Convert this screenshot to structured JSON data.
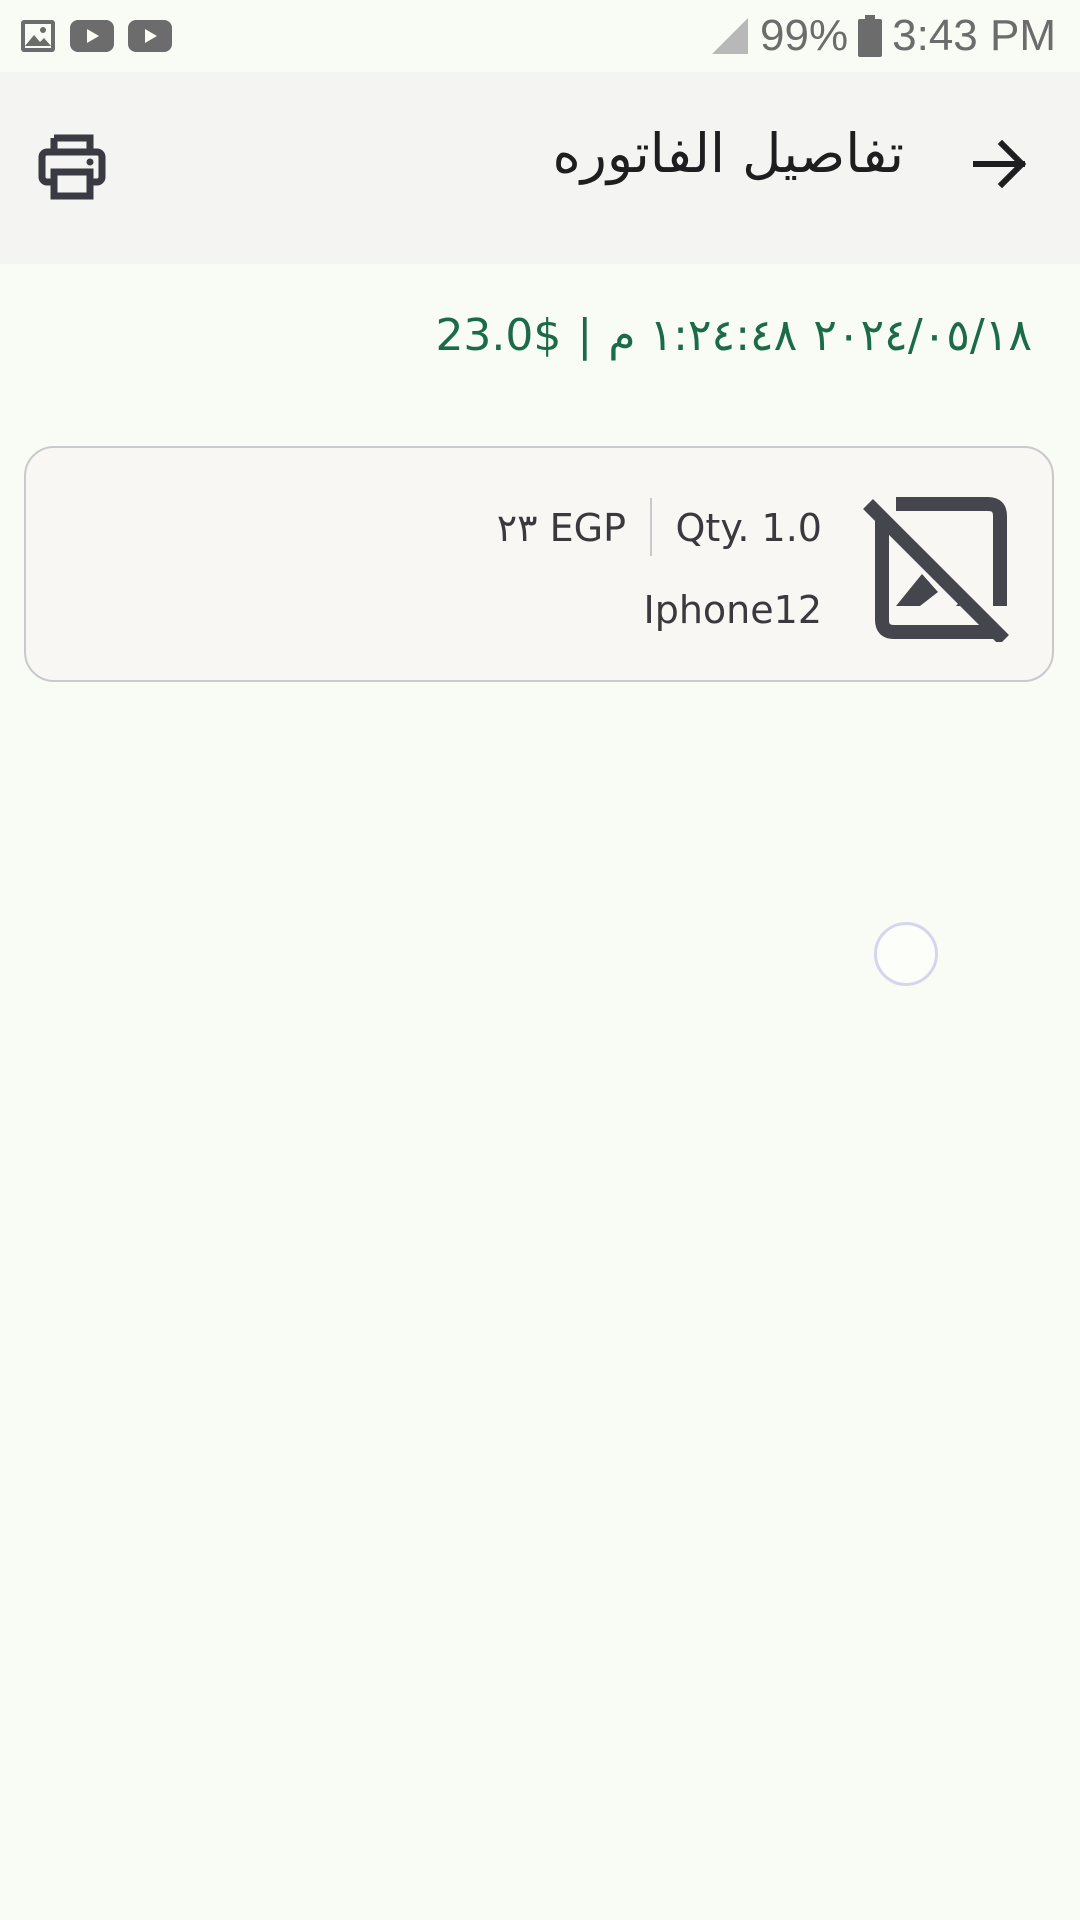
{
  "status_bar": {
    "notification_icons": [
      "gallery-icon",
      "youtube-icon",
      "youtube-icon"
    ],
    "signal_icon": "cellular-signal-icon",
    "battery_percent": "99%",
    "battery_icon": "battery-icon",
    "time": "3:43 PM"
  },
  "app_bar": {
    "title": "تفاصيل الفاتوره",
    "back_icon": "arrow-right-icon",
    "print_icon": "printer-icon"
  },
  "invoice": {
    "date": "٢٠٢٤/٠٥/١٨",
    "time": "١:٢٤:٤٨ م",
    "separator": "|",
    "total": "23.0$"
  },
  "items": [
    {
      "image_icon": "image-not-supported-icon",
      "qty": "Qty. 1.0",
      "price": "٢٣ EGP",
      "name": "Iphone12"
    }
  ],
  "colors": {
    "background": "#f9fcf4",
    "app_bar": "#f4f4f2",
    "accent_green": "#1b6b48",
    "card_border": "#c9c9cc"
  }
}
